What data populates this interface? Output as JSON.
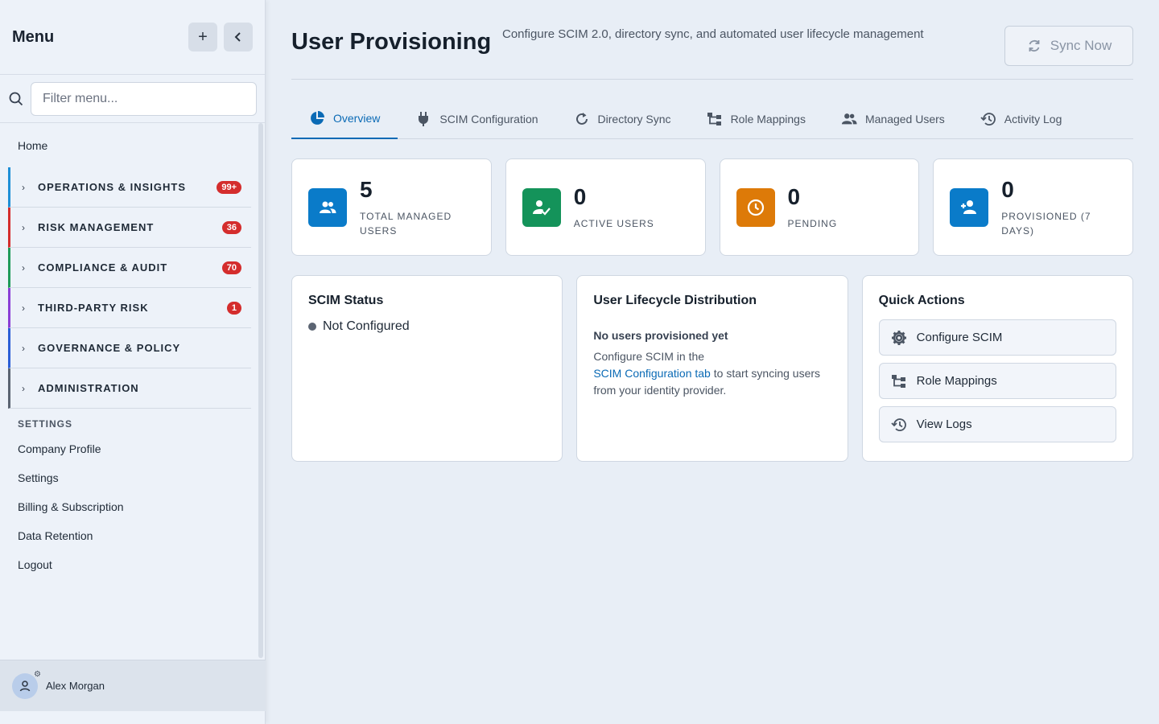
{
  "sidebar": {
    "title": "Menu",
    "search_placeholder": "Filter menu...",
    "home": "Home",
    "groups": [
      {
        "label": "OPERATIONS & INSIGHTS",
        "badge": "99+",
        "color": "#1e8fd6"
      },
      {
        "label": "RISK MANAGEMENT",
        "badge": "36",
        "color": "#d42d2d"
      },
      {
        "label": "COMPLIANCE & AUDIT",
        "badge": "70",
        "color": "#1f9a5a"
      },
      {
        "label": "THIRD-PARTY RISK",
        "badge": "1",
        "color": "#8b3fd6"
      },
      {
        "label": "GOVERNANCE & POLICY",
        "badge": "",
        "color": "#2a5ed6"
      },
      {
        "label": "ADMINISTRATION",
        "badge": "",
        "color": "#5b6472"
      }
    ],
    "section_label": "SETTINGS",
    "links": [
      "Company Profile",
      "Settings",
      "Billing & Subscription",
      "Data Retention",
      "Logout"
    ],
    "user_name": "Alex Morgan"
  },
  "header": {
    "title": "User Provisioning",
    "subtitle": "Configure SCIM 2.0, directory sync, and automated user lifecycle management",
    "sync_label": "Sync Now"
  },
  "tabs": [
    {
      "label": "Overview",
      "icon": "pie-chart-icon"
    },
    {
      "label": "SCIM Configuration",
      "icon": "plug-icon"
    },
    {
      "label": "Directory Sync",
      "icon": "refresh-icon"
    },
    {
      "label": "Role Mappings",
      "icon": "hierarchy-icon"
    },
    {
      "label": "Managed Users",
      "icon": "users-icon"
    },
    {
      "label": "Activity Log",
      "icon": "history-icon"
    }
  ],
  "stats": [
    {
      "value": "5",
      "label": "TOTAL MANAGED USERS",
      "color": "#0a7bc9",
      "icon": "users-icon"
    },
    {
      "value": "0",
      "label": "ACTIVE USERS",
      "color": "#14935a",
      "icon": "user-check-icon"
    },
    {
      "value": "0",
      "label": "PENDING",
      "color": "#dd7a08",
      "icon": "clock-icon"
    },
    {
      "value": "0",
      "label": "PROVISIONED (7 DAYS)",
      "color": "#0a7bc9",
      "icon": "user-plus-icon"
    }
  ],
  "scim_panel": {
    "title": "SCIM Status",
    "status": "Not Configured"
  },
  "lifecycle_panel": {
    "title": "User Lifecycle Distribution",
    "empty_title": "No users provisioned yet",
    "text_before": "Configure SCIM in the",
    "link": "SCIM Configuration tab",
    "text_after": "to start syncing users from your identity provider."
  },
  "quick_actions": {
    "title": "Quick Actions",
    "items": [
      "Configure SCIM",
      "Role Mappings",
      "View Logs"
    ]
  }
}
